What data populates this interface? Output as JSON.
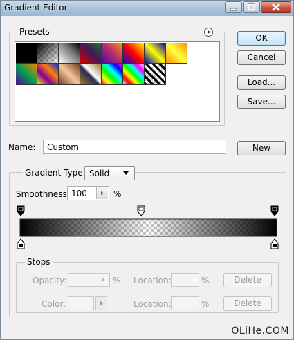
{
  "window": {
    "title": "Gradient Editor"
  },
  "presets": {
    "label": "Presets",
    "swatches": [
      {
        "name": "black-white"
      },
      {
        "name": "black-transparent"
      },
      {
        "name": "white-black"
      },
      {
        "name": "red-green"
      },
      {
        "name": "violet-orange"
      },
      {
        "name": "blue-red-yellow"
      },
      {
        "name": "blue-yellow-blue"
      },
      {
        "name": "orange-yellow-orange"
      },
      {
        "name": "violet-green-orange"
      },
      {
        "name": "yellow-violet-orange-blue"
      },
      {
        "name": "copper"
      },
      {
        "name": "chrome"
      },
      {
        "name": "spectrum"
      },
      {
        "name": "transparent-rainbow"
      },
      {
        "name": "transparent-stripes"
      }
    ]
  },
  "buttons": {
    "ok": "OK",
    "cancel": "Cancel",
    "load": "Load...",
    "save": "Save...",
    "new": "New"
  },
  "name": {
    "label": "Name:",
    "value": "Custom"
  },
  "gradient": {
    "type_label": "Gradient Type:",
    "type_value": "Solid",
    "smoothness_label": "Smoothness:",
    "smoothness_value": "100",
    "smoothness_unit": "%"
  },
  "stops": {
    "label": "Stops",
    "opacity_label": "Opacity:",
    "opacity_unit": "%",
    "location_label": "Location:",
    "location_unit": "%",
    "color_label": "Color:",
    "delete_label": "Delete"
  },
  "watermark": "OLiHe.COM",
  "colors": {
    "title_bar": "#a9c3da",
    "dialog_bg": "#f0f0f0",
    "default_button_border": "#3c7fb1"
  }
}
